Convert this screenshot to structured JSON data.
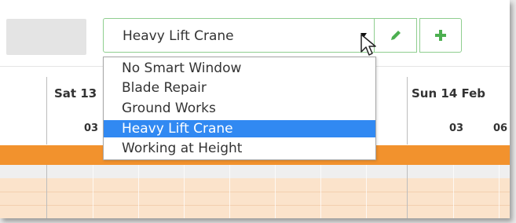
{
  "toolbar": {
    "selected_value": "Heavy Lift Crane",
    "edit_icon": "pencil-icon",
    "add_icon": "plus-icon",
    "accent_color": "#4caf50"
  },
  "dropdown": {
    "options": [
      "No Smart Window",
      "Blade Repair",
      "Ground Works",
      "Heavy Lift Crane",
      "Working at Height"
    ],
    "selected_index": 3,
    "highlight_color": "#3189f2"
  },
  "timeline": {
    "days": [
      {
        "label": "Sat 13",
        "ticks": [
          "03"
        ]
      },
      {
        "label": "Sun 14 Feb",
        "ticks": [
          "03",
          "06"
        ]
      }
    ],
    "band_color": "#f2922d"
  }
}
